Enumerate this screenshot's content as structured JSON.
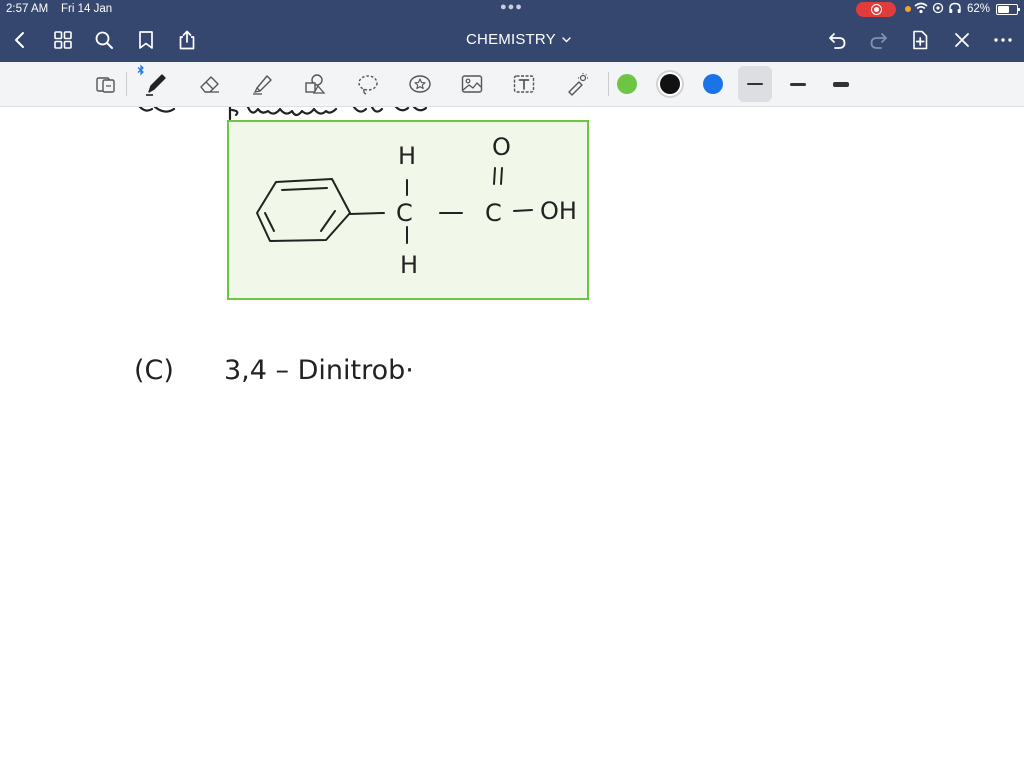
{
  "status_bar": {
    "time": "2:57 AM",
    "date": "Fri 14 Jan",
    "battery": "62%",
    "battery_level": 0.62,
    "icons": [
      "record-indicator-icon",
      "wifi-icon",
      "location-icon",
      "headphones-icon",
      "battery-icon"
    ]
  },
  "nav": {
    "title": "CHEMISTRY",
    "left_icons": [
      "back-icon",
      "grid-icon",
      "search-icon",
      "bookmark-icon",
      "share-icon"
    ],
    "right_icons": [
      "undo-icon",
      "redo-icon",
      "add-page-icon",
      "close-icon",
      "more-icon"
    ]
  },
  "toolbar": {
    "tools": [
      "lasso-tool",
      "pen-tool",
      "eraser-tool",
      "highlighter-tool",
      "shapes-tool",
      "lasso-select-tool",
      "sticker-tool",
      "image-tool",
      "text-tool",
      "laser-pointer-tool"
    ],
    "selected_tool": "pen-tool",
    "colors": [
      "#6cc644",
      "#111111",
      "#1a73e8"
    ],
    "selected_color": "#111111",
    "stroke_sizes": [
      "thin",
      "medium",
      "thick"
    ],
    "selected_stroke": "thin"
  },
  "canvas": {
    "box_fill": "#f1f8e9",
    "box_border": "#6cc644",
    "molecule": {
      "top_h": "H",
      "bottom_h": "H",
      "ch2_carbon": "C",
      "carbonyl_o": "O",
      "acid_carbon": "C",
      "hydroxyl": "OH"
    },
    "heading_fragment": "Phenylacetic",
    "item_c_label": "(C)",
    "item_c_text": "3,4 – Dinitrob·"
  }
}
